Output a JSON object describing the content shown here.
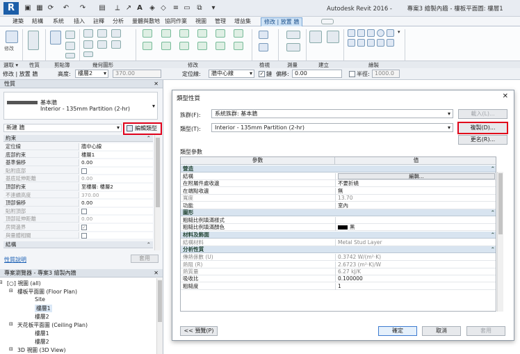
{
  "app_title": "Autodesk Revit 2016 -",
  "doc_title": "專案3 繪製內牆 - 樓板平面圖: 樓層1",
  "tabs": [
    "建築",
    "結構",
    "系統",
    "插入",
    "註釋",
    "分析",
    "量體與敷地",
    "協同作業",
    "視圖",
    "管理",
    "增益集",
    "修改 | 放置 牆"
  ],
  "ribbon_panels": {
    "modify": "修改",
    "select": "選取",
    "props": "性質",
    "clipboard": "剪貼簿",
    "geometry": "幾何圖形",
    "modify2": "修改",
    "view": "檢視",
    "measure": "測量",
    "create": "建立",
    "draw": "繪製"
  },
  "optbar": {
    "mode": "修改 | 放置 牆",
    "height_label": "高度:",
    "height_val": "樓層2",
    "offset_box": "370.00",
    "locline_label": "定位線:",
    "locline_val": "牆中心線",
    "chain_label": "鏈",
    "offset_label": "偏移:",
    "offset_val": "0.00",
    "radius_label": "半徑:",
    "radius_val": "1000.0"
  },
  "props": {
    "title": "性質",
    "type_name": "基本牆",
    "type_sub": "Interior - 135mm Partition (2-hr)",
    "new_label": "新建 牆",
    "edit_type": "編輯類型",
    "section_constraints": "約束",
    "section_struct": "結構",
    "help": "性質說明",
    "apply": "套用",
    "rows": [
      {
        "k": "定位線",
        "v": "牆中心線",
        "dim": false,
        "chk": false
      },
      {
        "k": "底部約束",
        "v": "樓層1",
        "dim": false,
        "chk": false
      },
      {
        "k": "基準偏移",
        "v": "0.00",
        "dim": false,
        "chk": false
      },
      {
        "k": "貼附底部",
        "v": "",
        "dim": true,
        "chk": true
      },
      {
        "k": "基底延伸距離",
        "v": "0.00",
        "dim": true,
        "chk": false
      },
      {
        "k": "頂部約束",
        "v": "至樓層: 樓層2",
        "dim": false,
        "chk": false
      },
      {
        "k": "不連續高度",
        "v": "370.00",
        "dim": true,
        "chk": false
      },
      {
        "k": "頂部偏移",
        "v": "0.00",
        "dim": false,
        "chk": false
      },
      {
        "k": "貼附頂部",
        "v": "",
        "dim": true,
        "chk": true
      },
      {
        "k": "頂部延伸距離",
        "v": "0.00",
        "dim": true,
        "chk": false
      },
      {
        "k": "房間邊界",
        "v": "✓",
        "dim": true,
        "chk": true
      },
      {
        "k": "與量體相關",
        "v": "",
        "dim": true,
        "chk": true
      }
    ]
  },
  "browser": {
    "title": "專案瀏覽器 - 專案3 繪製內牆",
    "nodes": [
      {
        "t": "[○] 視圖 (all)",
        "x": 10,
        "sel": false
      },
      {
        "t": "樓板平面圖 (Floor Plan)",
        "x": 25,
        "sel": false
      },
      {
        "t": "Site",
        "x": 50,
        "sel": false
      },
      {
        "t": "樓層1",
        "x": 50,
        "sel": true
      },
      {
        "t": "樓層2",
        "x": 50,
        "sel": false
      },
      {
        "t": "天花板平面圖 (Ceiling Plan)",
        "x": 25,
        "sel": false
      },
      {
        "t": "樓層1",
        "x": 50,
        "sel": false
      },
      {
        "t": "樓層2",
        "x": 50,
        "sel": false
      },
      {
        "t": "3D 視圖 (3D View)",
        "x": 25,
        "sel": false
      }
    ]
  },
  "dialog": {
    "title": "類型性質",
    "family_label": "族群(F):",
    "family_val": "系統族群: 基本牆",
    "type_label": "類型(T):",
    "type_val": "Interior - 135mm Partition (2-hr)",
    "load": "載入(L)...",
    "duplicate": "複製(D)...",
    "rename": "更名(R)...",
    "type_params": "類型參數",
    "col_param": "參數",
    "col_value": "值",
    "preview": "<< 預覽(P)",
    "ok": "確定",
    "cancel": "取消",
    "apply": "套用",
    "groups": [
      {
        "name": "營造",
        "rows": [
          {
            "k": "結構",
            "v": "編輯...",
            "btn": true,
            "dim": false
          },
          {
            "k": "在附屬件處收邊",
            "v": "不要折繞",
            "dim": false
          },
          {
            "k": "在端點收邊",
            "v": "無",
            "dim": false
          },
          {
            "k": "寬度",
            "v": "13.70",
            "dim": true
          },
          {
            "k": "功能",
            "v": "室內",
            "dim": false
          }
        ]
      },
      {
        "name": "圖形",
        "rows": [
          {
            "k": "粗糙比例填滿樣式",
            "v": "",
            "dim": false
          },
          {
            "k": "粗糙比例填滿顏色",
            "v": "黑",
            "swatch": true,
            "dim": false
          }
        ]
      },
      {
        "name": "材料及飾面",
        "rows": [
          {
            "k": "結構材料",
            "v": "Metal Stud Layer",
            "dim": true
          }
        ]
      },
      {
        "name": "分析性質",
        "rows": [
          {
            "k": "傳熱係數 (U)",
            "v": "0.3742 W/(m²·K)",
            "dim": true
          },
          {
            "k": "熱阻 (R)",
            "v": "2.6723 (m²·K)/W",
            "dim": true
          },
          {
            "k": "熱質量",
            "v": "6.27 kJ/K",
            "dim": true
          },
          {
            "k": "吸收比",
            "v": "0.100000",
            "dim": false
          },
          {
            "k": "粗糙度",
            "v": "1",
            "dim": false
          }
        ]
      }
    ]
  }
}
